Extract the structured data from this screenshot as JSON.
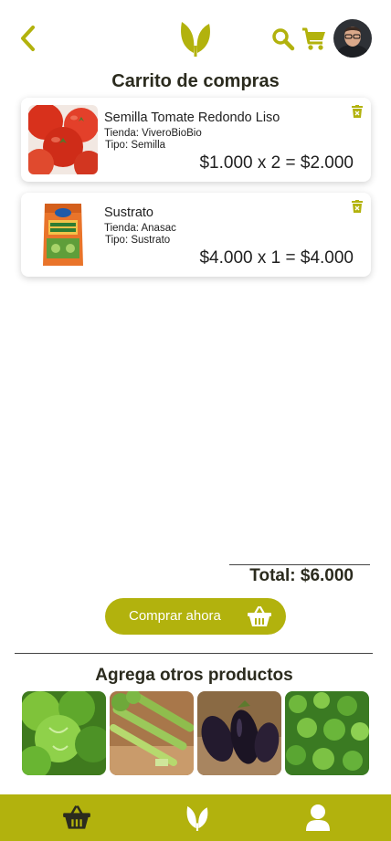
{
  "colors": {
    "accent": "#b2b20d",
    "text": "#2b2b1e"
  },
  "header": {
    "back_icon": "chevron-left-icon",
    "logo_icon": "leaf-logo-icon",
    "search_icon": "search-icon",
    "cart_icon": "shopping-cart-icon",
    "avatar": "user-avatar"
  },
  "page_title": "Carrito de compras",
  "cart": {
    "items": [
      {
        "name": "Semilla Tomate Redondo Liso",
        "store": "Tienda: ViveroBioBio",
        "type": "Tipo: Semilla",
        "price_line": "$1.000 x 2 = $2.000",
        "image": "tomatoes"
      },
      {
        "name": "Sustrato",
        "store": "Tienda: Anasac",
        "type": "Tipo: Sustrato",
        "price_line": "$4.000 x 1 = $4.000",
        "image": "substrate-bag"
      }
    ],
    "total": "Total: $6.000"
  },
  "buy_button": {
    "label": "Comprar ahora",
    "icon": "basket-icon"
  },
  "suggestions": {
    "title": "Agrega otros productos",
    "items": [
      "lettuce",
      "celery",
      "eggplant",
      "oregano"
    ]
  },
  "bottom_nav": {
    "items": [
      "basket-icon",
      "leaf-icon",
      "user-icon"
    ]
  }
}
